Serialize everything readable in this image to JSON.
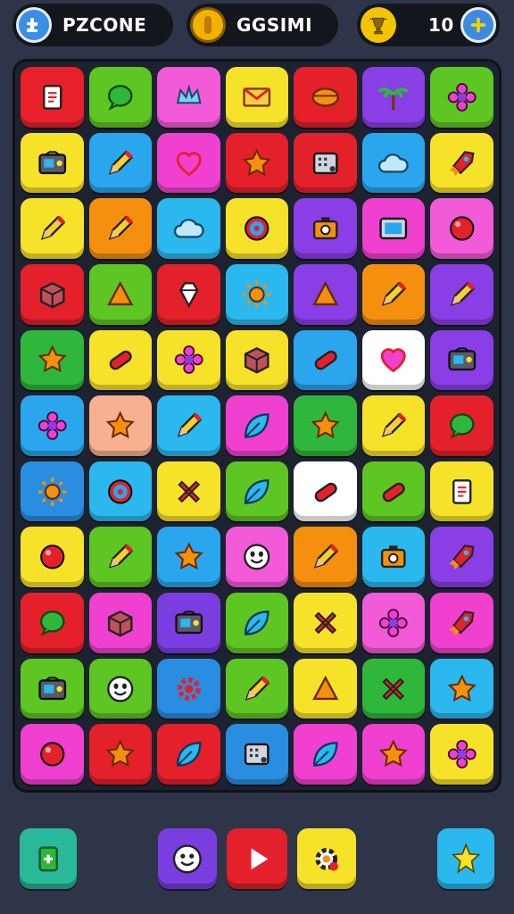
{
  "hud": {
    "left": {
      "label": "PZCONE",
      "icon": "puzzle-piece-icon",
      "color": "#3a8ee6"
    },
    "middle": {
      "label": "GGSIMI",
      "icon": "coin-icon",
      "color": "#f0b400"
    },
    "right": {
      "label": "10",
      "icon": "gem-trophy-icon",
      "color": "#f3c400",
      "action": "add"
    }
  },
  "board": {
    "rows": 11,
    "cols": 7,
    "tiles": [
      [
        {
          "color": "#e8202a",
          "icon": "paper"
        },
        {
          "color": "#5ec623",
          "icon": "speech"
        },
        {
          "color": "#f25ad8",
          "icon": "crown"
        },
        {
          "color": "#f7e22a",
          "icon": "envelope"
        },
        {
          "color": "#e4202a",
          "icon": "bowl"
        },
        {
          "color": "#8a3ee6",
          "icon": "palm"
        },
        {
          "color": "#5ec623",
          "icon": "flower"
        }
      ],
      [
        {
          "color": "#f7e22a",
          "icon": "radio"
        },
        {
          "color": "#2aa6ee",
          "icon": "pencil"
        },
        {
          "color": "#f040d0",
          "icon": "heart"
        },
        {
          "color": "#e4202a",
          "icon": "star"
        },
        {
          "color": "#e4202a",
          "icon": "board"
        },
        {
          "color": "#2aa6ee",
          "icon": "cloud"
        },
        {
          "color": "#f7e22a",
          "icon": "rocket"
        }
      ],
      [
        {
          "color": "#f7e22a",
          "icon": "pencil"
        },
        {
          "color": "#f5900f",
          "icon": "pencil"
        },
        {
          "color": "#2ab8ee",
          "icon": "cloud"
        },
        {
          "color": "#f7e22a",
          "icon": "target"
        },
        {
          "color": "#8a3ee6",
          "icon": "camera"
        },
        {
          "color": "#f040d0",
          "icon": "screen"
        },
        {
          "color": "#f25ad8",
          "icon": "circle"
        }
      ],
      [
        {
          "color": "#e4202a",
          "icon": "box"
        },
        {
          "color": "#5ec623",
          "icon": "triangle"
        },
        {
          "color": "#e4202a",
          "icon": "gem"
        },
        {
          "color": "#2ab8ee",
          "icon": "sun"
        },
        {
          "color": "#8a3ee6",
          "icon": "triangle"
        },
        {
          "color": "#f5900f",
          "icon": "pencil"
        },
        {
          "color": "#8a3ee6",
          "icon": "pencil"
        }
      ],
      [
        {
          "color": "#2fb73c",
          "icon": "star"
        },
        {
          "color": "#f7e22a",
          "icon": "capsule"
        },
        {
          "color": "#f7e22a",
          "icon": "flower"
        },
        {
          "color": "#f7e22a",
          "icon": "box"
        },
        {
          "color": "#2aa6ee",
          "icon": "capsule"
        },
        {
          "color": "#ffffff",
          "icon": "heart"
        },
        {
          "color": "#8a3ee6",
          "icon": "radio"
        }
      ],
      [
        {
          "color": "#2aa6ee",
          "icon": "flower"
        },
        {
          "color": "#f7b090",
          "icon": "star"
        },
        {
          "color": "#2ab8ee",
          "icon": "pencil"
        },
        {
          "color": "#f040d0",
          "icon": "leaf"
        },
        {
          "color": "#2fb73c",
          "icon": "star"
        },
        {
          "color": "#f7e22a",
          "icon": "pencil"
        },
        {
          "color": "#e4202a",
          "icon": "speech"
        }
      ],
      [
        {
          "color": "#2a8ee0",
          "icon": "sun"
        },
        {
          "color": "#2ab8ee",
          "icon": "target"
        },
        {
          "color": "#f7e22a",
          "icon": "cross"
        },
        {
          "color": "#5ec623",
          "icon": "leaf"
        },
        {
          "color": "#ffffff",
          "icon": "capsule"
        },
        {
          "color": "#5ec623",
          "icon": "capsule"
        },
        {
          "color": "#f7e22a",
          "icon": "paper"
        }
      ],
      [
        {
          "color": "#f7e22a",
          "icon": "circle"
        },
        {
          "color": "#5ec623",
          "icon": "pencil"
        },
        {
          "color": "#2aa6ee",
          "icon": "star"
        },
        {
          "color": "#f25ad8",
          "icon": "face"
        },
        {
          "color": "#f5900f",
          "icon": "pencil"
        },
        {
          "color": "#2ab8ee",
          "icon": "camera"
        },
        {
          "color": "#8a3ee6",
          "icon": "rocket"
        }
      ],
      [
        {
          "color": "#e4202a",
          "icon": "speech"
        },
        {
          "color": "#f040d0",
          "icon": "box"
        },
        {
          "color": "#7a3ee0",
          "icon": "radio"
        },
        {
          "color": "#5ec623",
          "icon": "leaf"
        },
        {
          "color": "#f7e22a",
          "icon": "cross"
        },
        {
          "color": "#f25ad8",
          "icon": "flower"
        },
        {
          "color": "#f040d0",
          "icon": "rocket"
        }
      ],
      [
        {
          "color": "#5ec623",
          "icon": "radio"
        },
        {
          "color": "#5ec623",
          "icon": "face"
        },
        {
          "color": "#2a8ee0",
          "icon": "gear"
        },
        {
          "color": "#5ec623",
          "icon": "pencil"
        },
        {
          "color": "#f7e22a",
          "icon": "triangle"
        },
        {
          "color": "#2fb73c",
          "icon": "cross"
        },
        {
          "color": "#2ab8ee",
          "icon": "star"
        }
      ],
      [
        {
          "color": "#f040d0",
          "icon": "circle"
        },
        {
          "color": "#e4202a",
          "icon": "star"
        },
        {
          "color": "#e4202a",
          "icon": "leaf"
        },
        {
          "color": "#2a8ee0",
          "icon": "board"
        },
        {
          "color": "#f040d0",
          "icon": "leaf"
        },
        {
          "color": "#f040d0",
          "icon": "star"
        },
        {
          "color": "#f7e22a",
          "icon": "flower"
        }
      ]
    ]
  },
  "bottom_bar": {
    "buttons": [
      {
        "name": "add-card-button",
        "icon": "add-card-icon",
        "color": "#2ab89a"
      },
      {
        "name": "face-button",
        "icon": "face-icon",
        "color": "#7a3ee0"
      },
      {
        "name": "play-button",
        "icon": "play-icon",
        "color": "#e4202a"
      },
      {
        "name": "settings-button",
        "icon": "gear-icon",
        "color": "#f7e22a"
      },
      {
        "name": "star-burst-button",
        "icon": "star-burst-icon",
        "color": "#2ab8ee"
      }
    ]
  }
}
